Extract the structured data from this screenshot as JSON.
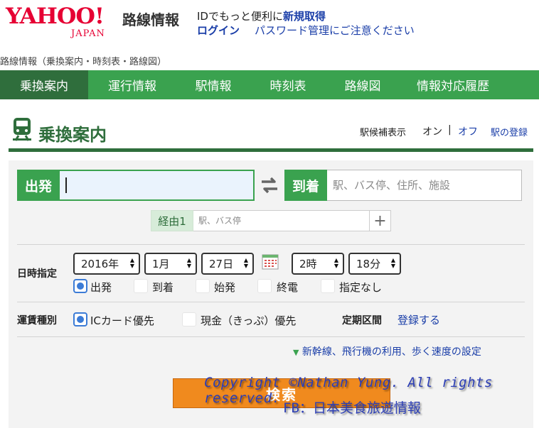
{
  "header": {
    "logo_text": "YAHOO!",
    "logo_sub": "JAPAN",
    "service_name": "路線情報",
    "id_promo_text": "IDでもっと便利に",
    "id_promo_link": "新規取得",
    "login_link": "ログイン",
    "password_notice": "パスワード管理にご注意ください"
  },
  "breadcrumb": "路線情報（乗換案内・時刻表・路線図）",
  "nav": {
    "tabs": [
      {
        "label": "乗換案内",
        "active": true
      },
      {
        "label": "運行情報",
        "active": false
      },
      {
        "label": "駅情報",
        "active": false
      },
      {
        "label": "時刻表",
        "active": false
      },
      {
        "label": "路線図",
        "active": false
      },
      {
        "label": "情報対応履歴",
        "active": false
      }
    ]
  },
  "section": {
    "title": "乗換案内",
    "icon": "train-icon",
    "suggest_label": "駅候補表示",
    "suggest_on": "オン",
    "suggest_sep": "|",
    "suggest_off": "オフ",
    "register_station": "駅の登録"
  },
  "form": {
    "departure_label": "出発",
    "departure_value": "",
    "arrival_label": "到着",
    "arrival_placeholder": "駅、バス停、住所、施設",
    "via_label": "経由1",
    "via_placeholder": "駅、バス停",
    "via_add": "+",
    "datetime_label": "日時指定",
    "year": "2016年",
    "month": "1月",
    "day": "27日",
    "hour": "2時",
    "minute": "18分",
    "time_types": [
      {
        "label": "出発",
        "selected": true
      },
      {
        "label": "到着",
        "selected": false
      },
      {
        "label": "始発",
        "selected": false
      },
      {
        "label": "終電",
        "selected": false
      },
      {
        "label": "指定なし",
        "selected": false
      }
    ],
    "fare_label": "運賃種別",
    "fare_types": [
      {
        "label": "ICカード優先",
        "selected": true
      },
      {
        "label": "現金（きっぷ）優先",
        "selected": false
      }
    ],
    "pass_label": "定期区間",
    "pass_link": "登録する",
    "options_link": "新幹線、飛行機の利用、歩く速度の設定",
    "search_button": "検索"
  },
  "watermark": {
    "line1": "Copyright ©Nathan Yung. All rights reserved.",
    "line2": "FB：日本美食旅遊情報"
  },
  "colors": {
    "brand_red": "#e60033",
    "nav_green": "#3aa24f",
    "nav_active": "#2f6e3c",
    "link_blue": "#1a3ea8",
    "search_orange": "#f08a1e",
    "radio_blue": "#3b7bd6"
  }
}
